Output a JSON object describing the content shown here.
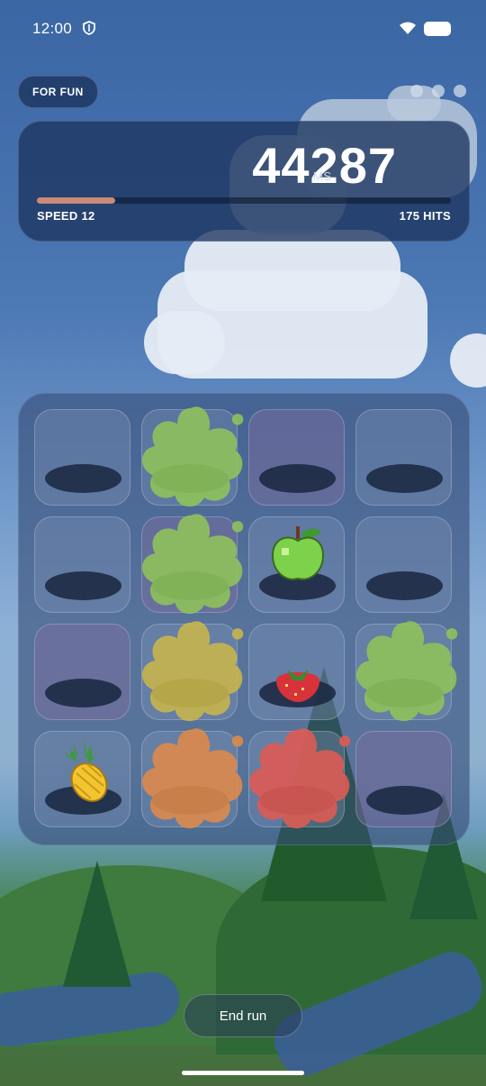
{
  "status_bar": {
    "time": "12:00",
    "icons": [
      "shield-icon",
      "wifi-icon",
      "battery-icon"
    ]
  },
  "header": {
    "mode_label": "FOR FUN",
    "menu_dots": 3
  },
  "score_panel": {
    "score": "44287",
    "unit": "MS",
    "speed_label": "SPEED 12",
    "hits_label": "175 HITS",
    "progress_fraction": 0.19
  },
  "board": {
    "rows": 4,
    "cols": 4,
    "cells": [
      {
        "row": 0,
        "col": 0,
        "content": "empty"
      },
      {
        "row": 0,
        "col": 1,
        "content": "green-splat"
      },
      {
        "row": 0,
        "col": 2,
        "content": "empty"
      },
      {
        "row": 0,
        "col": 3,
        "content": "empty"
      },
      {
        "row": 1,
        "col": 0,
        "content": "empty"
      },
      {
        "row": 1,
        "col": 1,
        "content": "green-splat"
      },
      {
        "row": 1,
        "col": 2,
        "content": "green-apple"
      },
      {
        "row": 1,
        "col": 3,
        "content": "empty"
      },
      {
        "row": 2,
        "col": 0,
        "content": "empty"
      },
      {
        "row": 2,
        "col": 1,
        "content": "yellow-splat"
      },
      {
        "row": 2,
        "col": 2,
        "content": "strawberry"
      },
      {
        "row": 2,
        "col": 3,
        "content": "green-splat"
      },
      {
        "row": 3,
        "col": 0,
        "content": "pineapple"
      },
      {
        "row": 3,
        "col": 1,
        "content": "orange-splat"
      },
      {
        "row": 3,
        "col": 2,
        "content": "red-splat"
      },
      {
        "row": 3,
        "col": 3,
        "content": "empty"
      }
    ]
  },
  "colors": {
    "splat_green": "#8fc45a",
    "splat_yellow": "#c9b64a",
    "splat_orange": "#e08a4a",
    "splat_red": "#e05a52",
    "panel": "#1c345f",
    "progress": "#c98a7a"
  },
  "footer": {
    "end_run_label": "End run"
  }
}
